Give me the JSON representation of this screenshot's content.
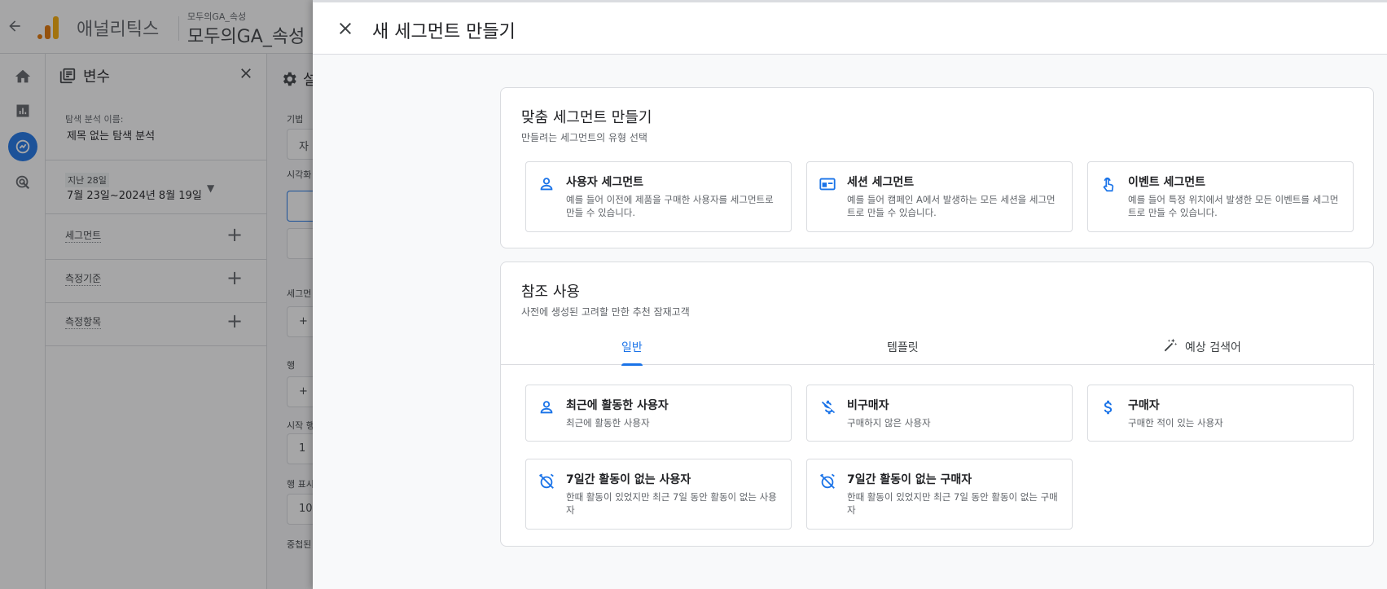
{
  "topbar": {
    "app_name": "애널리틱스",
    "property_small": "모두의GA_속성",
    "property_big": "모두의GA_속성"
  },
  "variables_panel": {
    "title": "변수",
    "exploration_name_label": "탐색 분석 이름:",
    "exploration_name": "제목 없는 탐색 분석",
    "date_chip": "지난 28일",
    "date_range": "7월 23일~2024년 8월 19일",
    "rows": [
      {
        "label": "세그먼트"
      },
      {
        "label": "측정기준"
      },
      {
        "label": "측정항목"
      }
    ]
  },
  "settings_panel": {
    "title": "설",
    "labels": [
      "기법",
      "시각화",
      "세그먼",
      "행",
      "시작 행",
      "행 표시",
      "중첩된"
    ],
    "technique_value": "자",
    "start_row_value": "1",
    "show_rows_value": "10",
    "plus": "+"
  },
  "drawer": {
    "title": "새 세그먼트 만들기",
    "custom": {
      "title": "맞춤 세그먼트 만들기",
      "subtitle": "만들려는 세그먼트의 유형 선택",
      "options": [
        {
          "icon": "person-icon",
          "title": "사용자 세그먼트",
          "desc": "예를 들어 이전에 제품을 구매한 사용자를 세그먼트로 만들 수 있습니다."
        },
        {
          "icon": "session-icon",
          "title": "세션 세그먼트",
          "desc": "예를 들어 캠페인 A에서 발생하는 모든 세션을 세그먼트로 만들 수 있습니다."
        },
        {
          "icon": "touch-icon",
          "title": "이벤트 세그먼트",
          "desc": "예를 들어 특정 위치에서 발생한 모든 이벤트를 세그먼트로 만들 수 있습니다."
        }
      ]
    },
    "reference": {
      "title": "참조 사용",
      "subtitle": "사전에 생성된 고려할 만한 추천 잠재고객",
      "tabs": [
        {
          "label": "일반",
          "active": true
        },
        {
          "label": "템플릿",
          "active": false
        },
        {
          "label": "예상 검색어",
          "active": false,
          "icon": "magic-wand-icon"
        }
      ],
      "suggestions": [
        {
          "icon": "person-icon",
          "title": "최근에 활동한 사용자",
          "desc": "최근에 활동한 사용자"
        },
        {
          "icon": "money-off-icon",
          "title": "비구매자",
          "desc": "구매하지 않은 사용자"
        },
        {
          "icon": "dollar-icon",
          "title": "구매자",
          "desc": "구매한 적이 있는 사용자"
        },
        {
          "icon": "alarm-off-icon",
          "title": "7일간 활동이 없는 사용자",
          "desc": "한때 활동이 있었지만 최근 7일 동안 활동이 없는 사용자"
        },
        {
          "icon": "alarm-off-icon",
          "title": "7일간 활동이 없는 구매자",
          "desc": "한때 활동이 있었지만 최근 7일 동안 활동이 없는 구매자"
        }
      ]
    }
  },
  "colors": {
    "accent": "#1a73e8",
    "overlay": "rgba(32,33,36,0.40)"
  }
}
